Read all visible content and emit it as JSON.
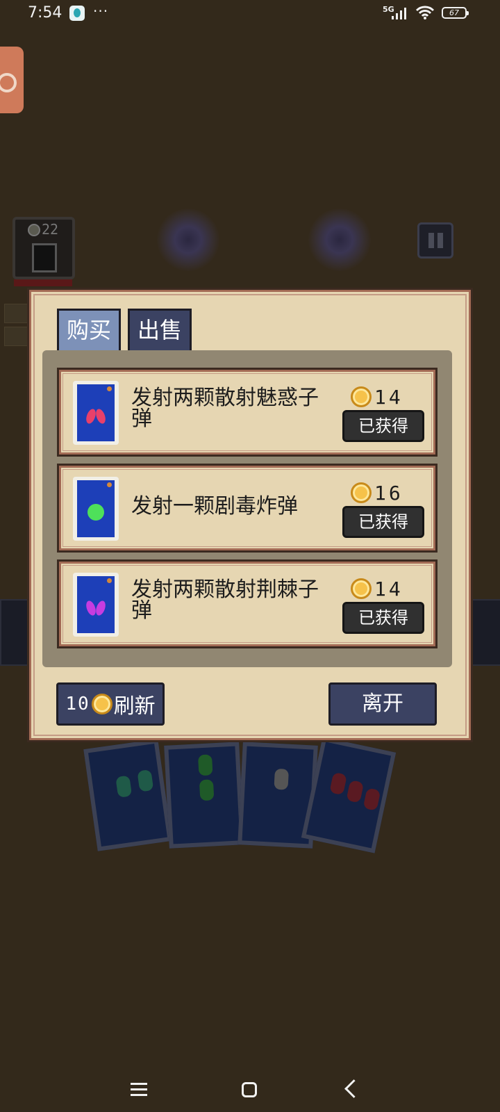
{
  "status_bar": {
    "time": "7:54",
    "network": "5G",
    "battery": "67"
  },
  "hud": {
    "player_coins": "22"
  },
  "shop": {
    "tabs": [
      {
        "label": "购买"
      },
      {
        "label": "出售"
      }
    ],
    "items": [
      {
        "name": "发射两颗散射魅惑子弹",
        "price": "14",
        "status": "已获得",
        "gem_color": "#e8406a"
      },
      {
        "name": "发射一颗剧毒炸弹",
        "price": "16",
        "status": "已获得",
        "gem_color": "#4ee05a"
      },
      {
        "name": "发射两颗散射荆棘子弹",
        "price": "14",
        "status": "已获得",
        "gem_color": "#c63ce0"
      }
    ],
    "refresh": {
      "cost": "10",
      "label": "刷新"
    },
    "leave_label": "离开"
  },
  "colors": {
    "background": "#33291b",
    "panel": "#e6d6b2",
    "tab_active": "#7d91b8",
    "button": "#3b4262",
    "card_blue": "#1d3fb8",
    "coin": "#f6c24a"
  },
  "icons": [
    "app-badge-icon",
    "signal-icon",
    "wifi-icon",
    "battery-icon",
    "pause-icon",
    "coin-icon",
    "menu-icon",
    "home-icon",
    "back-icon"
  ]
}
